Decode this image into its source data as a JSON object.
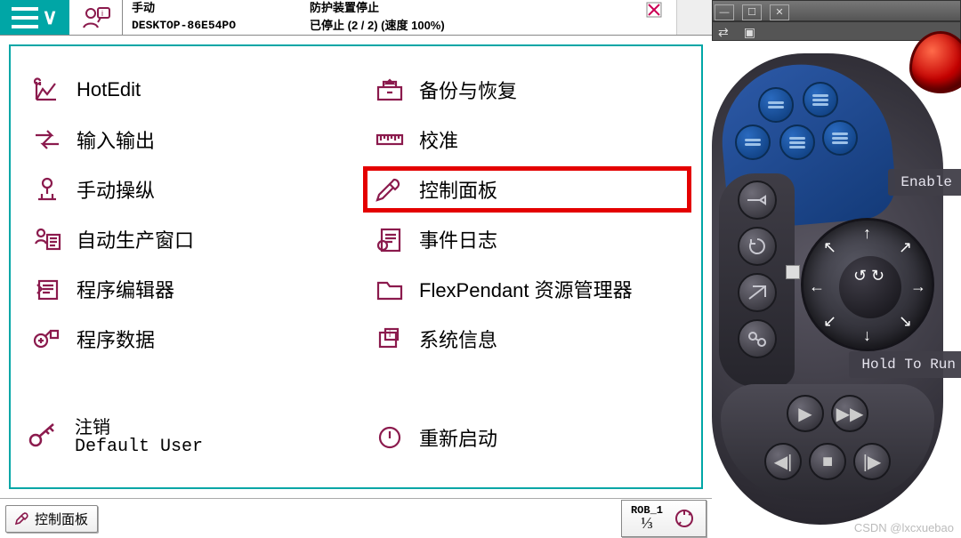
{
  "header": {
    "mode": "手动",
    "hostname": "DESKTOP-86E54PO",
    "guard": "防护装置停止",
    "stopped": "已停止 (2 / 2) (速度 100%)"
  },
  "menu": {
    "left": [
      {
        "id": "hotedit",
        "label": "HotEdit"
      },
      {
        "id": "io",
        "label": "输入输出"
      },
      {
        "id": "jog",
        "label": "手动操纵"
      },
      {
        "id": "prod",
        "label": "自动生产窗口"
      },
      {
        "id": "progedit",
        "label": "程序编辑器"
      },
      {
        "id": "progdata",
        "label": "程序数据"
      }
    ],
    "right": [
      {
        "id": "backup",
        "label": "备份与恢复"
      },
      {
        "id": "calib",
        "label": "校准"
      },
      {
        "id": "ctrl",
        "label": "控制面板",
        "highlight": true
      },
      {
        "id": "events",
        "label": "事件日志"
      },
      {
        "id": "explorer",
        "label": "FlexPendant 资源管理器"
      },
      {
        "id": "sysinfo",
        "label": "系统信息"
      }
    ]
  },
  "logoff": {
    "title": "注销",
    "user": "Default User"
  },
  "restart": {
    "label": "重新启动"
  },
  "taskbar": {
    "btn": "控制面板",
    "rob": "ROB_1",
    "page": "⅓"
  },
  "controller": {
    "enable": "Enable",
    "hold": "Hold To Run"
  },
  "watermark": "CSDN @lxcxuebao"
}
